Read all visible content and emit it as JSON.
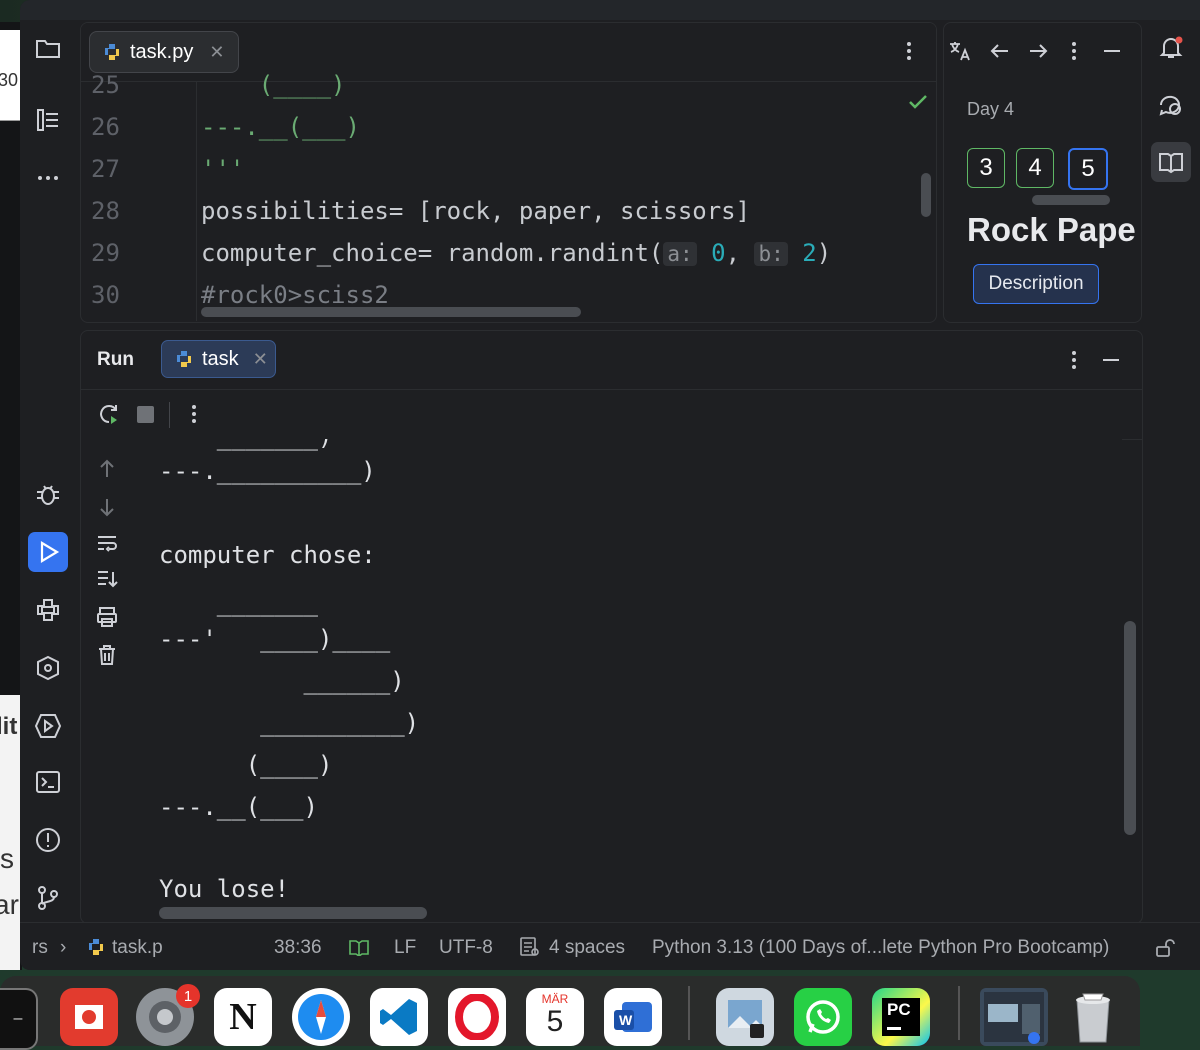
{
  "editor": {
    "tab_label": "task.py",
    "lines": [
      {
        "n": "25",
        "text": "    (____)"
      },
      {
        "n": "26",
        "text": "---.__(___)"
      },
      {
        "n": "27",
        "text": "'''"
      },
      {
        "n": "28",
        "text": "possibilities= [rock, paper, scissors]"
      },
      {
        "n": "29",
        "pre": "computer_choice= random.randint(",
        "hint_a": "a:",
        "val_a": "0",
        "hint_b": "b:",
        "val_b": "2",
        "post": ")"
      },
      {
        "n": "30",
        "text": "#rock0>sciss2"
      }
    ]
  },
  "course": {
    "day_label": "Day 4",
    "days": [
      "3",
      "4",
      "5"
    ],
    "title": "Rock Pape",
    "description_button": "Description"
  },
  "run": {
    "title": "Run",
    "tab_label": "task",
    "output": [
      "    _______)",
      "---.__________)",
      "",
      "computer chose:",
      "",
      "    _______",
      "---'   ____)____",
      "          ______)",
      "       __________)",
      "      (____)",
      "---.__(___)",
      "",
      "You lose!"
    ]
  },
  "status": {
    "breadcrumb_root": "rs",
    "breadcrumb_file": "task.p",
    "position": "38:36",
    "line_ending": "LF",
    "encoding": "UTF-8",
    "indent": "4 spaces",
    "interpreter": "Python 3.13 (100 Days of...lete Python Pro Bootcamp)"
  },
  "dock": {
    "calendar_month": "MÄR",
    "calendar_day": "5",
    "settings_badge": "1",
    "pycharm_label": "PC"
  },
  "peek": {
    "top_text": "30",
    "mid_text_1": "lit",
    "mid_text_2": "s",
    "mid_text_3": "ar"
  },
  "colors": {
    "accent": "#3574f0",
    "code_green": "#6aab73",
    "number_cyan": "#2aacb8"
  }
}
